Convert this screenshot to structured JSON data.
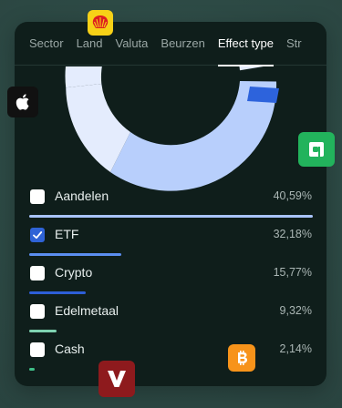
{
  "tabs": [
    {
      "label": "Sector"
    },
    {
      "label": "Land"
    },
    {
      "label": "Valuta"
    },
    {
      "label": "Beurzen"
    },
    {
      "label": "Effect type"
    },
    {
      "label": "Str"
    }
  ],
  "active_tab": "Effect type",
  "allocation": [
    {
      "label": "Aandelen",
      "percent_text": "40,59%",
      "percent": 40.59,
      "checked": false,
      "color": "#a9c4fb"
    },
    {
      "label": "ETF",
      "percent_text": "32,18%",
      "percent": 32.18,
      "checked": true,
      "color": "#5b8ef0"
    },
    {
      "label": "Crypto",
      "percent_text": "15,77%",
      "percent": 15.77,
      "checked": false,
      "color": "#2d5fd8"
    },
    {
      "label": "Edelmetaal",
      "percent_text": "9,32%",
      "percent": 9.32,
      "checked": false,
      "color": "#7fd3b1"
    },
    {
      "label": "Cash",
      "percent_text": "2,14%",
      "percent": 2.14,
      "checked": false,
      "color": "#3fbf88"
    }
  ],
  "donut_colors": {
    "aandelen": "#b8cffc",
    "etf": "#e4ecfd",
    "crypto": "#2d63dc"
  },
  "floating_icons": [
    {
      "name": "shell-icon"
    },
    {
      "name": "apple-icon"
    },
    {
      "name": "a-logo-icon"
    },
    {
      "name": "bitcoin-icon"
    },
    {
      "name": "v-logo-icon"
    }
  ]
}
